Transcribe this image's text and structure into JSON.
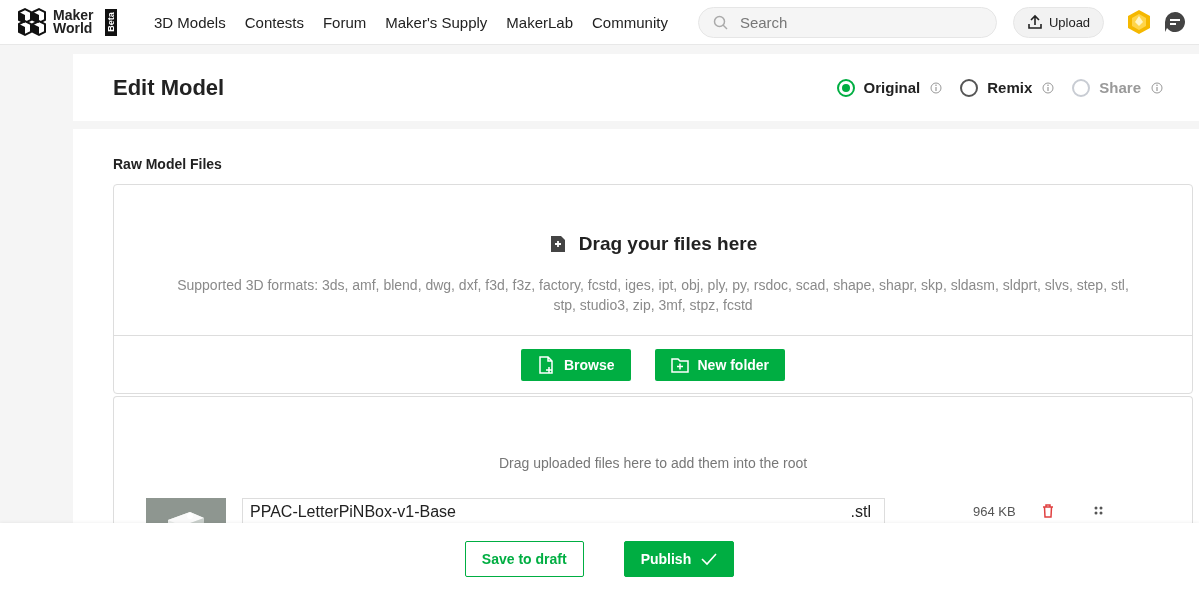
{
  "header": {
    "logo_text": "Maker World",
    "beta_badge": "Beta",
    "nav": [
      "3D Models",
      "Contests",
      "Forum",
      "Maker's Supply",
      "MakerLab",
      "Community"
    ],
    "search": {
      "placeholder": "Search"
    },
    "upload_button": "Upload"
  },
  "page": {
    "title": "Edit Model",
    "types": [
      {
        "label": "Original",
        "selected": true,
        "disabled": false
      },
      {
        "label": "Remix",
        "selected": false,
        "disabled": false
      },
      {
        "label": "Share",
        "selected": false,
        "disabled": true
      }
    ]
  },
  "raw_files": {
    "heading": "Raw Model Files",
    "dropzone": {
      "title": "Drag your files here",
      "formats": "Supported 3D formats: 3ds, amf, blend, dwg, dxf, f3d, f3z, factory, fcstd, iges, ipt, obj, ply, py, rsdoc, scad, shape, shapr, skp, sldasm, sldprt, slvs, step, stl, stp, studio3, zip, 3mf, stpz, fcstd"
    },
    "buttons": [
      {
        "kind": "file",
        "label": "Browse"
      },
      {
        "kind": "folder",
        "label": "New folder"
      }
    ],
    "root_hint": "Drag uploaded files here to add them into the root",
    "files": [
      {
        "name": "PPAC-LetterPiNBox-v1-Base",
        "extension": ".stl",
        "size": "964 KB"
      }
    ]
  },
  "footer": {
    "save_draft": "Save to draft",
    "publish": "Publish"
  }
}
